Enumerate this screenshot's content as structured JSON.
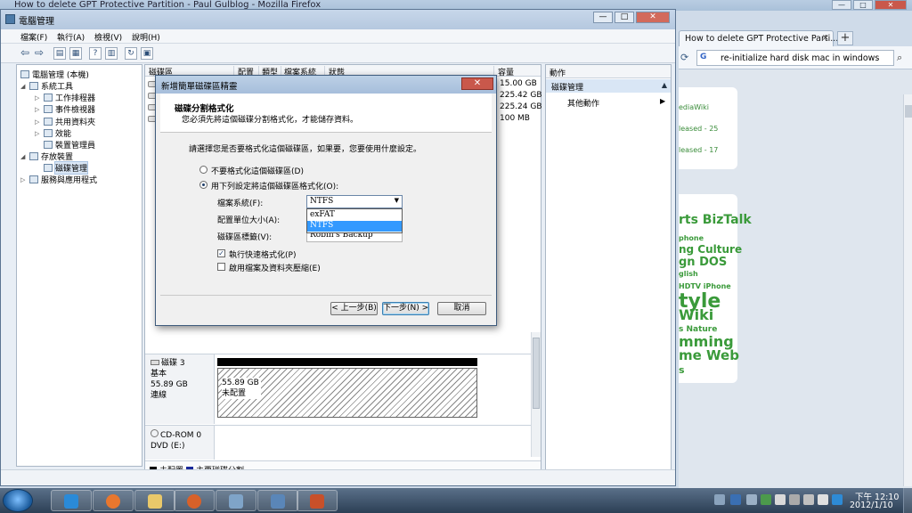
{
  "browser": {
    "title": "How to delete GPT Protective Partition - Paul Gulblog - Mozilla Firefox",
    "tab_label": "How to delete GPT Protective Parti...",
    "tab_close": "×",
    "new_tab": "+",
    "search_text": "re-initialize hard disk mac in windows",
    "controls": {
      "minimize": "—",
      "maximize": "□",
      "close": "✕"
    },
    "page_fragments": {
      "card1": [
        "ediaWiki",
        "leased - 25",
        "leased - 17"
      ],
      "tags": [
        {
          "text": "rts BizTalk",
          "size": 14
        },
        {
          "text": "phone",
          "size": 8
        },
        {
          "text": "ng Culture",
          "size": 12
        },
        {
          "text": "gn DOS",
          "size": 13
        },
        {
          "text": "glish",
          "size": 8
        },
        {
          "text": "HDTV iPhone",
          "size": 8
        },
        {
          "text": "tyle",
          "size": 22
        },
        {
          "text": "Wiki",
          "size": 16
        },
        {
          "text": "s Nature",
          "size": 9
        },
        {
          "text": "mming",
          "size": 16
        },
        {
          "text": "me Web",
          "size": 15
        },
        {
          "text": "s",
          "size": 11
        }
      ]
    }
  },
  "cm": {
    "title": "電腦管理",
    "controls": {
      "minimize": "—",
      "maximize": "□",
      "close": "✕"
    },
    "menu": [
      "檔案(F)",
      "執行(A)",
      "檢視(V)",
      "說明(H)"
    ],
    "toolbar_icons": [
      "back-icon",
      "forward-icon",
      "up-folder-icon",
      "show-hide-tree-icon",
      "help-icon",
      "properties-icon",
      "refresh-icon",
      "export-icon"
    ],
    "tree": {
      "root": "電腦管理 (本機)",
      "system_tools": "系統工具",
      "task_scheduler": "工作排程器",
      "event_viewer": "事件檢視器",
      "shared_folders": "共用資料夾",
      "performance": "效能",
      "device_manager": "裝置管理員",
      "storage": "存放裝置",
      "disk_management": "磁碟管理",
      "services_apps": "服務與應用程式"
    },
    "volume_columns": [
      "磁碟區",
      "配置",
      "類型",
      "檔案系統",
      "狀態",
      "容量"
    ],
    "capacities": [
      "15.00 GB",
      "225.42 GB",
      "225.24 GB",
      "100 MB"
    ],
    "disk3": {
      "name": "磁碟 3",
      "type": "基本",
      "size": "55.89 GB",
      "status": "連線",
      "part_size": "55.89 GB",
      "part_status": "未配置"
    },
    "cdrom": {
      "name": "CD-ROM 0",
      "drive": "DVD (E:)"
    },
    "legend": {
      "unallocated": "未配置",
      "primary": "主要磁碟分割"
    },
    "actions": {
      "header": "動作",
      "section": "磁碟管理",
      "more": "其他動作"
    }
  },
  "wizard": {
    "title": "新增簡單磁碟區精靈",
    "close": "✕",
    "head_title": "磁碟分割格式化",
    "head_sub": "您必須先將這個磁碟分割格式化，才能儲存資料。",
    "prompt": "請選擇您是否要格式化這個磁碟區，如果要，您要使用什麼設定。",
    "opt_no_format": "不要格式化這個磁碟區(D)",
    "opt_format": "用下列設定將這個磁碟區格式化(O):",
    "fs_label": "檔案系統(F):",
    "fs_value": "NTFS",
    "fs_options": [
      "exFAT",
      "NTFS"
    ],
    "alloc_label": "配置單位大小(A):",
    "vol_label_label": "磁碟區標籤(V):",
    "vol_label_value": "Robin's Backup",
    "quick_format": "執行快速格式化(P)",
    "quick_format_checked": true,
    "compression": "啟用檔案及資料夾壓縮(E)",
    "compression_checked": false,
    "btn_back": "< 上一步(B)",
    "btn_next": "下一步(N) >",
    "btn_cancel": "取消"
  },
  "taskbar": {
    "pinned": [
      "internet-explorer-icon",
      "firefox-icon",
      "explorer-icon",
      "firefox-window-icon",
      "computer-management-icon",
      "remote-desktop-icon",
      "powerpoint-icon"
    ],
    "time": "下午 12:10",
    "date": "2012/1/10"
  }
}
